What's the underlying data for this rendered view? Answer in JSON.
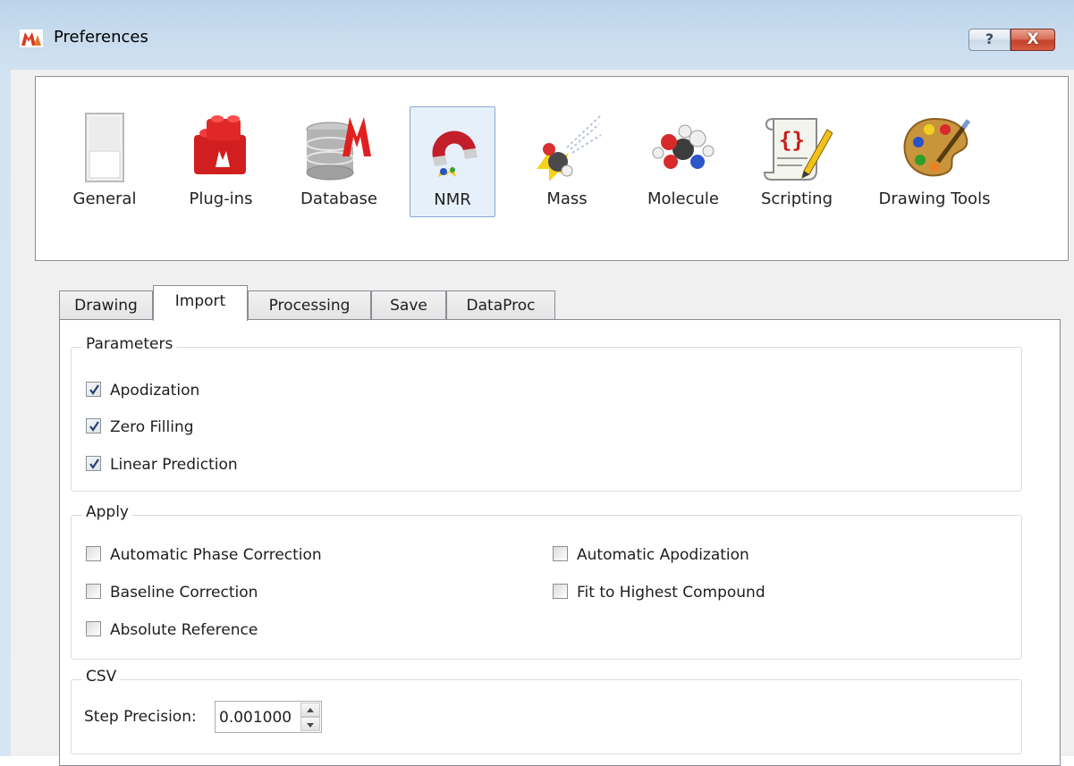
{
  "window": {
    "title": "Preferences",
    "help_button": "?",
    "close_button": "X"
  },
  "categories": [
    {
      "label": "General",
      "icon": "general-panel-icon",
      "selected": false
    },
    {
      "label": "Plug-ins",
      "icon": "plugin-blocks-icon",
      "selected": false
    },
    {
      "label": "Database",
      "icon": "database-icon",
      "selected": false
    },
    {
      "label": "NMR",
      "icon": "nmr-magnet-icon",
      "selected": true
    },
    {
      "label": "Mass",
      "icon": "mass-spec-icon",
      "selected": false
    },
    {
      "label": "Molecule",
      "icon": "molecule-icon",
      "selected": false
    },
    {
      "label": "Scripting",
      "icon": "script-scroll-icon",
      "selected": false
    },
    {
      "label": "Drawing Tools",
      "icon": "palette-icon",
      "selected": false
    }
  ],
  "tabs": [
    {
      "label": "Drawing",
      "active": false
    },
    {
      "label": "Import",
      "active": true
    },
    {
      "label": "Processing",
      "active": false
    },
    {
      "label": "Save",
      "active": false
    },
    {
      "label": "DataProc",
      "active": false
    }
  ],
  "parameters": {
    "title": "Parameters",
    "items": [
      {
        "label": "Apodization",
        "checked": true
      },
      {
        "label": "Zero Filling",
        "checked": true
      },
      {
        "label": "Linear Prediction",
        "checked": true
      }
    ]
  },
  "apply": {
    "title": "Apply",
    "items": [
      {
        "label": "Automatic Phase Correction",
        "checked": false
      },
      {
        "label": "Automatic Apodization",
        "checked": false
      },
      {
        "label": "Baseline Correction",
        "checked": false
      },
      {
        "label": "Fit to Highest Compound",
        "checked": false
      },
      {
        "label": "Absolute Reference",
        "checked": false
      }
    ]
  },
  "csv": {
    "title": "CSV",
    "step_precision_label": "Step Precision:",
    "step_precision_value": "0.001000"
  },
  "colors": {
    "selected_bg": "#e6f0fa",
    "selected_border": "#89a9cf",
    "close_red": "#c4412a"
  }
}
